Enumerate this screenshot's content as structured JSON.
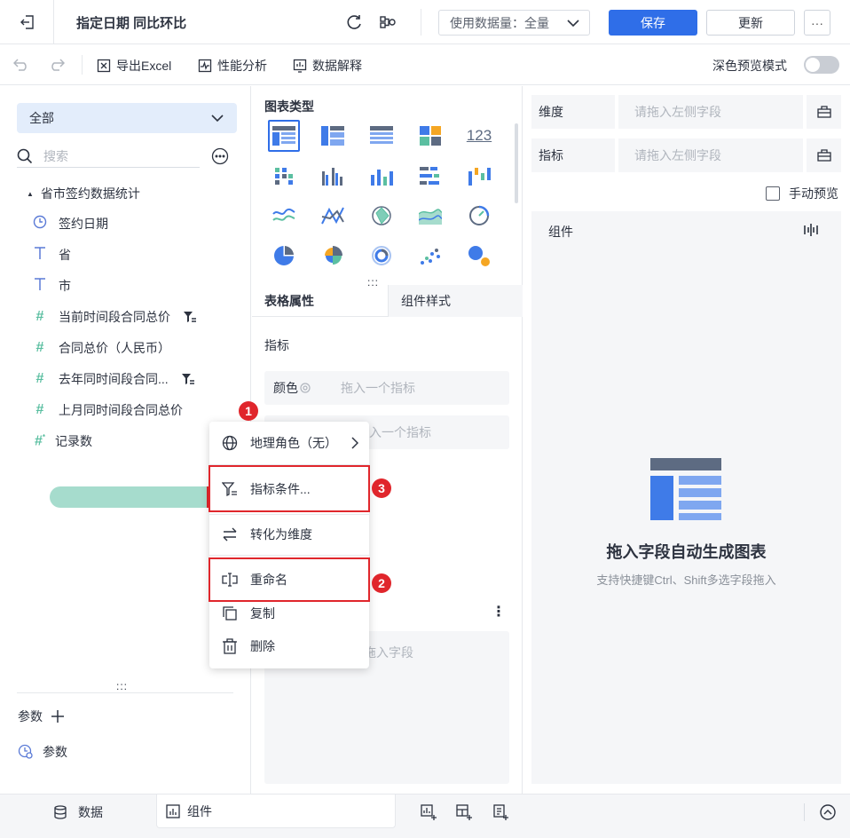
{
  "header": {
    "title": "指定日期 同比环比",
    "data_amount": "使用数据量：全量",
    "save_label": "保存",
    "update_label": "更新",
    "more_label": "···"
  },
  "toolbar": {
    "export_label": "导出Excel",
    "perf_label": "性能分析",
    "explain_label": "数据解释",
    "dark_preview_label": "深色预览模式",
    "dark_preview_on": false
  },
  "left": {
    "scope": "全部",
    "search_placeholder": "搜索",
    "dataset": "省市签约数据统计",
    "fields": [
      {
        "icon": "clock-icon",
        "label": "签约日期"
      },
      {
        "icon": "text-icon",
        "label": "省"
      },
      {
        "icon": "text-icon",
        "label": "市"
      },
      {
        "icon": "hash-icon",
        "label": "当前时间段合同总价",
        "filter": true
      },
      {
        "icon": "hash-icon",
        "label": "合同总价（人民币）"
      },
      {
        "icon": "hash-icon",
        "label": "去年同时间段合同...",
        "filter": true
      },
      {
        "icon": "hash-icon",
        "label": "上月同时间段合同总价",
        "selected": true
      },
      {
        "icon": "hash-star-icon",
        "label": "记录数"
      }
    ],
    "params_label": "参数",
    "param_item": "参数",
    "handle": ":::"
  },
  "menu": {
    "items": [
      {
        "icon": "globe-icon",
        "label": "地理角色（无）",
        "arrow": true
      },
      {
        "icon": "filter-icon",
        "label": "指标条件..."
      },
      {
        "icon": "swap-icon",
        "label": "转化为维度"
      },
      {
        "icon": "rename-icon",
        "label": "重命名"
      },
      {
        "icon": "copy-icon",
        "label": "复制"
      },
      {
        "icon": "trash-icon",
        "label": "删除"
      }
    ]
  },
  "badges": [
    "1",
    "2",
    "3"
  ],
  "middle": {
    "chart_types_title": "图表类型",
    "chart_icon_123": "123",
    "tab_table_props": "表格属性",
    "tab_component_style": "组件样式",
    "metrics_label": "指标",
    "color_label": "颜色",
    "drop_one_metric": "拖入一个指标",
    "drop_one_metric_2": "入一个指标",
    "drop_field_partial": "拖入字段",
    "handle": ":::",
    "kebab": "⋮"
  },
  "right": {
    "dimension_label": "维度",
    "metric_label": "指标",
    "drop_left_field": "请拖入左侧字段",
    "manual_preview": "手动预览",
    "component_label": "组件",
    "empty_title": "拖入字段自动生成图表",
    "empty_hint": "支持快捷键Ctrl、Shift多选字段拖入"
  },
  "bottom": {
    "data_tab": "数据",
    "component_tab": "组件"
  },
  "colors": {
    "primary": "#2f6ee8",
    "accent_green": "#5bbfa1",
    "highlight_red": "#e0262c",
    "selected_bg": "#a6dccd"
  }
}
